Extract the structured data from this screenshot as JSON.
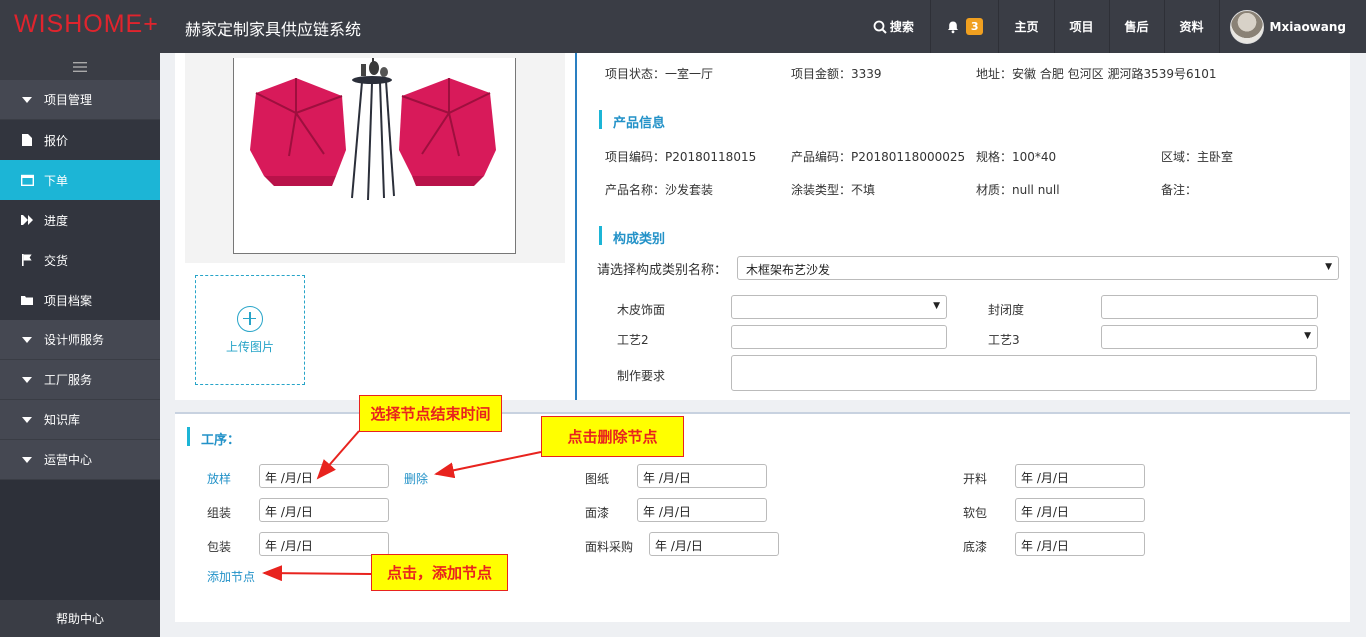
{
  "header": {
    "logo": "WISHOME+",
    "app_title": "赫家定制家具供应链系统",
    "search_label": "搜索",
    "notification_count": "3",
    "nav": [
      "主页",
      "项目",
      "售后",
      "资料"
    ],
    "username": "Mxiaowang"
  },
  "sidebar": {
    "items": [
      {
        "label": "项目管理",
        "type": "group",
        "icon": "caret-down-icon"
      },
      {
        "label": "报价",
        "type": "sub",
        "icon": "document-icon"
      },
      {
        "label": "下单",
        "type": "sub",
        "icon": "calendar-icon",
        "active": true
      },
      {
        "label": "进度",
        "type": "sub",
        "icon": "fast-forward-icon"
      },
      {
        "label": "交货",
        "type": "sub",
        "icon": "flag-icon"
      },
      {
        "label": "项目档案",
        "type": "sub",
        "icon": "folder-icon"
      },
      {
        "label": "设计师服务",
        "type": "group",
        "icon": "caret-down-icon"
      },
      {
        "label": "工厂服务",
        "type": "group",
        "icon": "caret-down-icon"
      },
      {
        "label": "知识库",
        "type": "group",
        "icon": "caret-down-icon"
      },
      {
        "label": "运营中心",
        "type": "group",
        "icon": "caret-down-icon"
      }
    ],
    "help": "帮助中心"
  },
  "upload": {
    "label": "上传图片"
  },
  "project": {
    "status": "项目状态：一室一厅",
    "amount": "项目金额：3339",
    "address": "地址：安徽 合肥 包河区 淝河路3539号6101"
  },
  "product_info": {
    "title": "产品信息",
    "project_code": "项目编码：P20180118015",
    "product_code": "产品编码：P20180118000025",
    "spec": "规格：100*40",
    "area": "区域：主卧室",
    "product_name": "产品名称：沙发套装",
    "coating": "涂装类型：不填",
    "material": "材质：null null",
    "remark": "备注："
  },
  "composition": {
    "title": "构成类别",
    "select_label": "请选择构成类别名称：",
    "select_value": "木框架布艺沙发",
    "veneer_label": "木皮饰面",
    "closure_label": "封闭度",
    "craft2_label": "工艺2",
    "craft3_label": "工艺3",
    "requirement_label": "制作要求"
  },
  "process": {
    "title": "工序：",
    "date_placeholder": "年 /月/日",
    "nodes": [
      {
        "label": "放样"
      },
      {
        "label": "图纸"
      },
      {
        "label": "开料"
      },
      {
        "label": "组装"
      },
      {
        "label": "面漆"
      },
      {
        "label": "软包"
      },
      {
        "label": "包装"
      },
      {
        "label": "面料采购"
      },
      {
        "label": "底漆"
      }
    ],
    "delete_label": "删除",
    "add_label": "添加节点"
  },
  "annotations": {
    "select_end_time": "选择节点结束时间",
    "click_delete": "点击删除节点",
    "click_add": "点击，添加节点"
  },
  "colors": {
    "header_bg": "#3a3d45",
    "sidebar_active": "#1cb5d6",
    "logo": "#e0242d",
    "link": "#2392c8",
    "callout_bg": "#ffff00",
    "callout_text": "#e8231e"
  }
}
